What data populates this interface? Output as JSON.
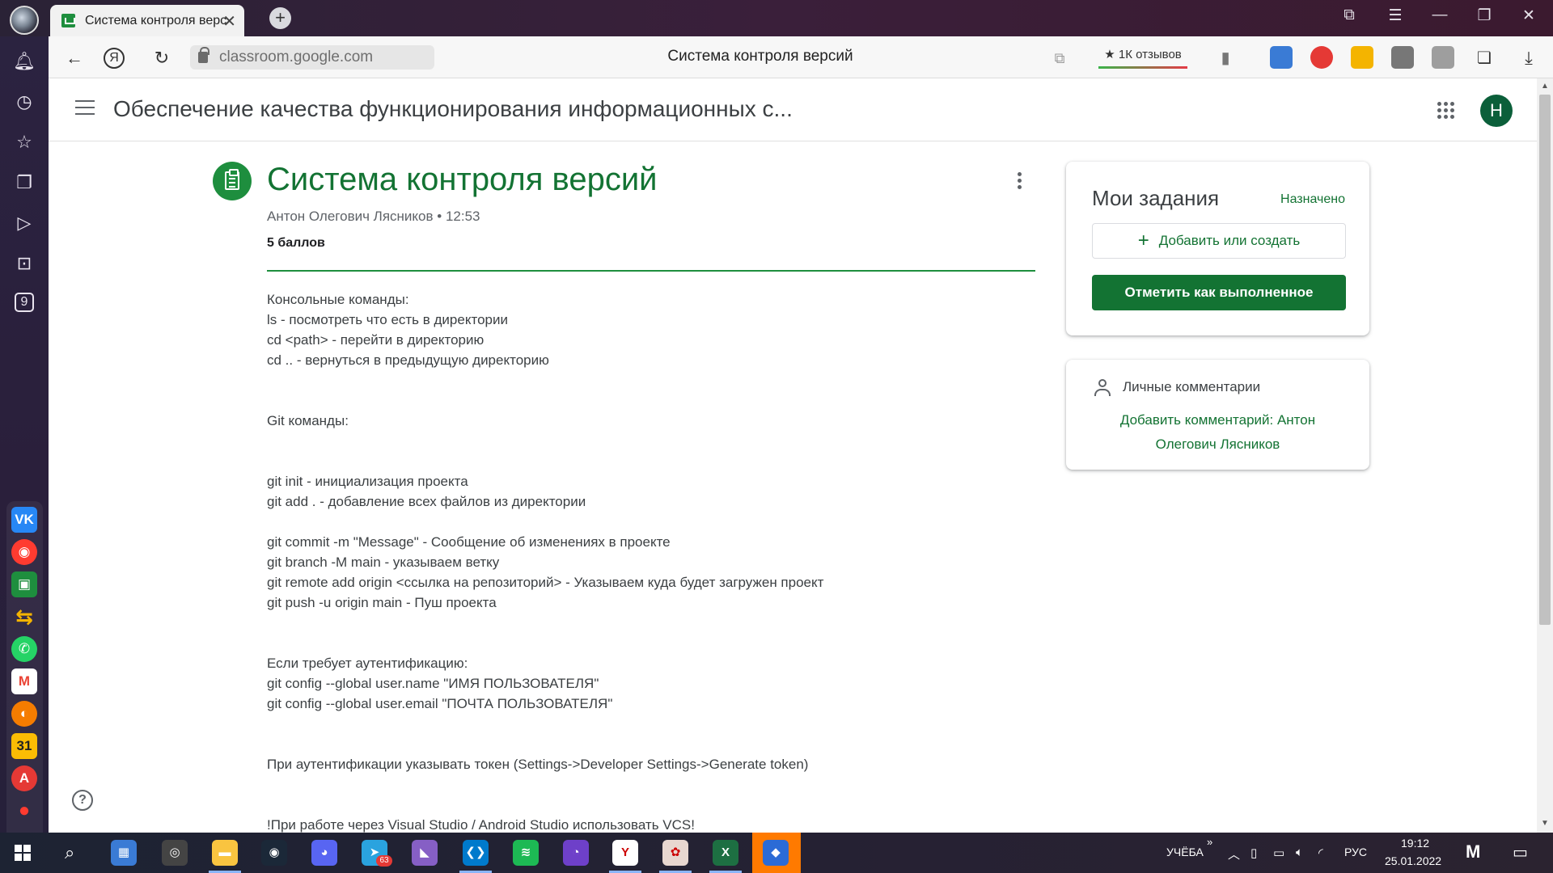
{
  "browser": {
    "tab_title": "Система контроля версий",
    "tab_close": "✕",
    "new_tab": "+",
    "url": "classroom.google.com",
    "page_title": "Система контроля версий",
    "reviews": "★ 1К отзывов",
    "window_controls": [
      "⧉",
      "☰",
      "—",
      "❐",
      "✕"
    ]
  },
  "yandex_sidebar": {
    "items": [
      "bell-icon",
      "history-icon",
      "star-icon",
      "collections-icon",
      "play-icon",
      "camera-icon",
      "number-9-icon"
    ],
    "apps": [
      {
        "name": "vk",
        "label": "VK",
        "color": "#2787f5"
      },
      {
        "name": "yandex-music",
        "label": "◉",
        "color": "#ff3b30"
      },
      {
        "name": "google-classroom",
        "label": "▣",
        "color": "#1e8e3e"
      },
      {
        "name": "arrows",
        "label": "⇆",
        "color": "#f4b400"
      },
      {
        "name": "whatsapp",
        "label": "✆",
        "color": "#25d366"
      },
      {
        "name": "gmail",
        "label": "M",
        "color": "#ea4335"
      },
      {
        "name": "yandex-disk",
        "label": "◐",
        "color": "#f57c00"
      },
      {
        "name": "calendar",
        "label": "31",
        "color": "#fbbc04"
      },
      {
        "name": "translate",
        "label": "A",
        "color": "#e53935"
      },
      {
        "name": "maps",
        "label": "●",
        "color": "#ff3b30"
      }
    ],
    "add_label": "+",
    "number_badge": "9"
  },
  "classroom": {
    "course_title": "Обеспечение качества функционирования информационных с...",
    "avatar_letter": "Н",
    "assignment": {
      "title": "Система контроля версий",
      "meta": "Антон Олегович Лясников • 12:53",
      "points": "5 баллов",
      "description": [
        "Консольные команды:",
        "ls - посмотреть что есть в директории",
        "cd <path> - перейти в директорию",
        "cd .. - вернуться в предыдущую директорию",
        "",
        "",
        "Git команды:",
        "",
        "",
        "git init - инициализация проекта",
        "git add . - добавление всех файлов из директории",
        "",
        "git commit -m \"Message\" - Сообщение об изменениях в проекте",
        "git branch -M main - указываем ветку",
        "git remote add origin <ссылка на репозиторий> - Указываем куда будет загружен проект",
        "git push -u origin main - Пуш проекта",
        "",
        "",
        "Если требует аутентификацию:",
        "git config --global user.name \"ИМЯ ПОЛЬЗОВАТЕЛЯ\"",
        "git config --global user.email \"ПОЧТА ПОЛЬЗОВАТЕЛЯ\"",
        "",
        "",
        "При аутентификации указывать токен (Settings->Developer Settings->Generate token)",
        "",
        "",
        "!При работе через Visual Studio / Android Studio использовать VCS!"
      ]
    },
    "my_work": {
      "title": "Мои задания",
      "status": "Назначено",
      "add_button": "Добавить или создать",
      "done_button": "Отметить как выполненное"
    },
    "private_comments": {
      "title": "Личные комментарии",
      "add_link": "Добавить комментарий: Антон Олегович Лясников"
    },
    "help": "?"
  },
  "taskbar": {
    "apps": [
      {
        "name": "calculator",
        "label": "▦",
        "color": "#3a7bd5"
      },
      {
        "name": "obs",
        "label": "◎",
        "color": "#444"
      },
      {
        "name": "explorer",
        "label": "▬",
        "color": "#f9c440"
      },
      {
        "name": "steam",
        "label": "◉",
        "color": "#1b2838"
      },
      {
        "name": "discord",
        "label": "◕",
        "color": "#5865f2"
      },
      {
        "name": "telegram",
        "label": "➤",
        "color": "#2aa3df"
      },
      {
        "name": "visual-studio",
        "label": "◣",
        "color": "#865fc5"
      },
      {
        "name": "vscode",
        "label": "❮❯",
        "color": "#007acc"
      },
      {
        "name": "spotify",
        "label": "≋",
        "color": "#1db954"
      },
      {
        "name": "github-desktop",
        "label": "◔",
        "color": "#6e40c9"
      },
      {
        "name": "yandex-browser",
        "label": "Y",
        "color": "#ffffff"
      },
      {
        "name": "anime-app",
        "label": "✿",
        "color": "#e8d7d0"
      },
      {
        "name": "excel",
        "label": "X",
        "color": "#1d6f42"
      },
      {
        "name": "app-blue",
        "label": "◆",
        "color": "#2b6bd6"
      }
    ],
    "telegram_badge": "63",
    "keyboard_layout_label": "УЧЁБА",
    "language": "РУС",
    "time": "19:12",
    "date": "25.01.2022"
  }
}
